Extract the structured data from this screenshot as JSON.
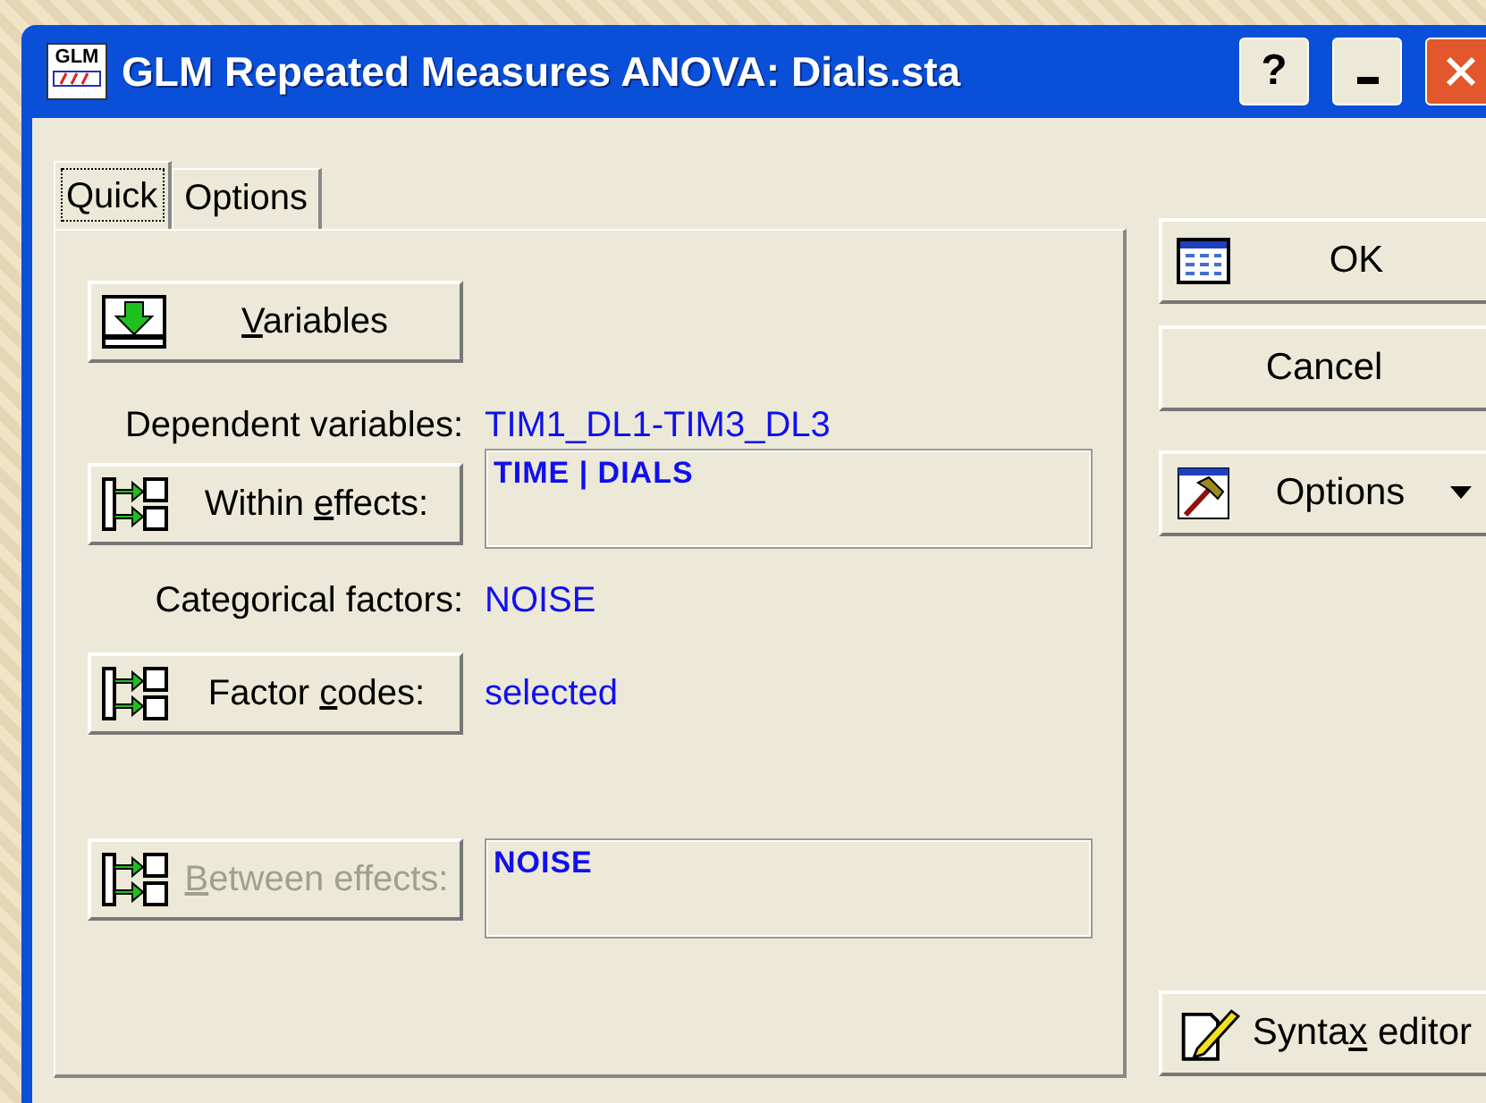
{
  "window": {
    "icon_text": "GLM",
    "title": "GLM Repeated Measures ANOVA: Dials.sta",
    "controls": [
      {
        "kind": "help",
        "label": "?"
      },
      {
        "kind": "minimize"
      },
      {
        "kind": "close"
      }
    ]
  },
  "tabs": [
    {
      "label": "Quick",
      "selected": true
    },
    {
      "label": "Options",
      "selected": false
    }
  ],
  "variables_button": {
    "label_parts": {
      "key": "V",
      "after": "ariables"
    },
    "disabled": false
  },
  "dependent": {
    "label": "Dependent variables:",
    "value": "TIM1_DL1-TIM3_DL3"
  },
  "within_effects": {
    "label_parts": {
      "before": "Within ",
      "key": "e",
      "after": "ffects:"
    },
    "disabled": false,
    "value": "TIME | DIALS"
  },
  "categorical": {
    "label": "Categorical factors:",
    "value": "NOISE"
  },
  "factor_codes": {
    "label_parts": {
      "before": "Factor ",
      "key": "c",
      "after": "odes:"
    },
    "disabled": false,
    "value": "selected"
  },
  "between_effects": {
    "label_parts": {
      "key": "B",
      "after": "etween effects:"
    },
    "disabled": true,
    "value": "NOISE"
  },
  "side_buttons": [
    {
      "kind": "ok",
      "label": "OK"
    },
    {
      "kind": "plain",
      "label": "Cancel"
    },
    {
      "kind": "menu",
      "label": "Options"
    }
  ],
  "syntax_button": {
    "label_parts": {
      "before": "Synta",
      "key": "x",
      "after": " editor"
    }
  }
}
